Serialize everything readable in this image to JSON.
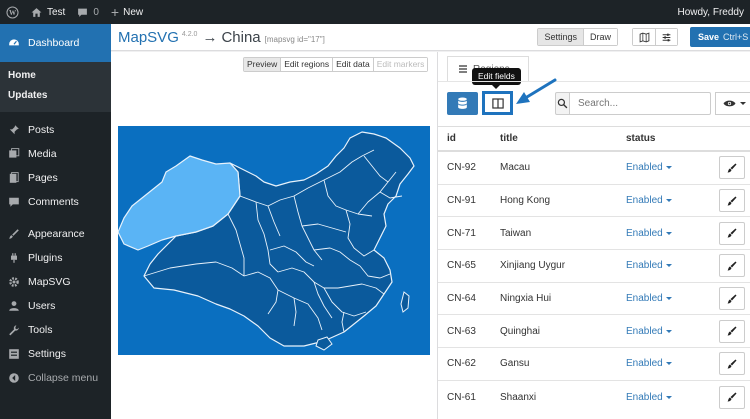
{
  "adminbar": {
    "site_name": "Test",
    "comments_count": "0",
    "new_label": "New",
    "greeting": "Howdy, Freddy"
  },
  "sidebar": {
    "dashboard": "Dashboard",
    "sub": [
      "Home",
      "Updates"
    ],
    "items": [
      "Posts",
      "Media",
      "Pages",
      "Comments",
      "Appearance",
      "Plugins",
      "MapSVG",
      "Users",
      "Tools",
      "Settings"
    ],
    "collapse": "Collapse menu"
  },
  "header": {
    "app_name": "MapSVG",
    "version": "4.2.0",
    "arrow": "→",
    "map_name": "China",
    "shortcode": "[mapsvg id=\"17\"]",
    "settings_label": "Settings",
    "draw_label": "Draw",
    "save_label": "Save",
    "save_shortcut": "Ctrl+S"
  },
  "mode_tabs": [
    "Preview",
    "Edit regions",
    "Edit data",
    "Edit markers"
  ],
  "panel": {
    "regions_label": "Regions",
    "tooltip": "Edit fields",
    "search_placeholder": "Search..."
  },
  "table": {
    "columns": [
      "id",
      "title",
      "status"
    ],
    "rows": [
      {
        "id": "CN-92",
        "title": "Macau",
        "status": "Enabled"
      },
      {
        "id": "CN-91",
        "title": "Hong Kong",
        "status": "Enabled"
      },
      {
        "id": "CN-71",
        "title": "Taiwan",
        "status": "Enabled"
      },
      {
        "id": "CN-65",
        "title": "Xinjiang Uygur",
        "status": "Enabled"
      },
      {
        "id": "CN-64",
        "title": "Ningxia Hui",
        "status": "Enabled"
      },
      {
        "id": "CN-63",
        "title": "Quinghai",
        "status": "Enabled"
      },
      {
        "id": "CN-62",
        "title": "Gansu",
        "status": "Enabled"
      },
      {
        "id": "CN-61",
        "title": "Shaanxi",
        "status": "Enabled"
      }
    ]
  },
  "colors": {
    "wp_dark": "#1d2327",
    "wp_blue": "#2271b1",
    "map_bg": "#0a6fc0",
    "map_region": "#0b5a9c",
    "map_highlight": "#5ab4f5",
    "annotation": "#1e73be"
  }
}
